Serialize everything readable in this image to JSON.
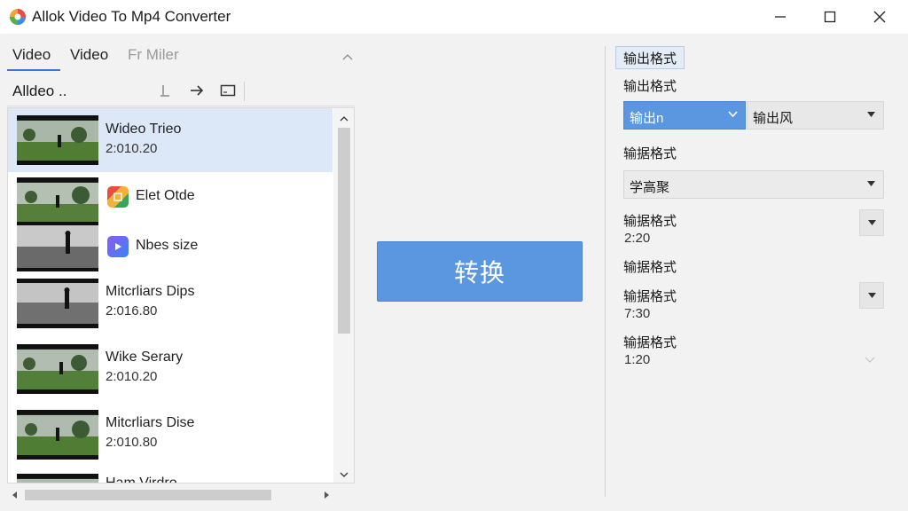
{
  "window": {
    "title": "Allok Video To Mp4 Converter"
  },
  "tabs": [
    "Video",
    "Video",
    "Fr Miler"
  ],
  "toolbar": {
    "label": "Alldeo .."
  },
  "files": [
    {
      "title": "Wideo Trieo",
      "duration": "2:010.20",
      "selected": true
    },
    {
      "title": "Elet Otde",
      "duration": "",
      "badge": "google-colors-icon"
    },
    {
      "title": "Nbes size",
      "duration": "",
      "badge": "play-icon"
    },
    {
      "title": "Mitcrliars Dips",
      "duration": "2:016.80"
    },
    {
      "title": "Wike Serary",
      "duration": "2:010.20"
    },
    {
      "title": "Mitcrliars Dise",
      "duration": "2:010.80"
    },
    {
      "title": "Ham Virdro",
      "duration": ""
    }
  ],
  "convert_button": {
    "label": "转换"
  },
  "settings": {
    "tab": "输出格式",
    "output_format_label": "输出格式",
    "output_format_value": "输出n",
    "output_format_value2": "输出风",
    "label2": "输据格式",
    "select2_value": "学高聚",
    "label3": "输据格式",
    "value3": "2:20",
    "label4": "输据格式",
    "label5": "输据格式",
    "value5": "7:30",
    "label6": "输据格式",
    "value6": "1:20"
  },
  "colors": {
    "accent": "#5a97e0",
    "selection": "#dce8f8"
  }
}
